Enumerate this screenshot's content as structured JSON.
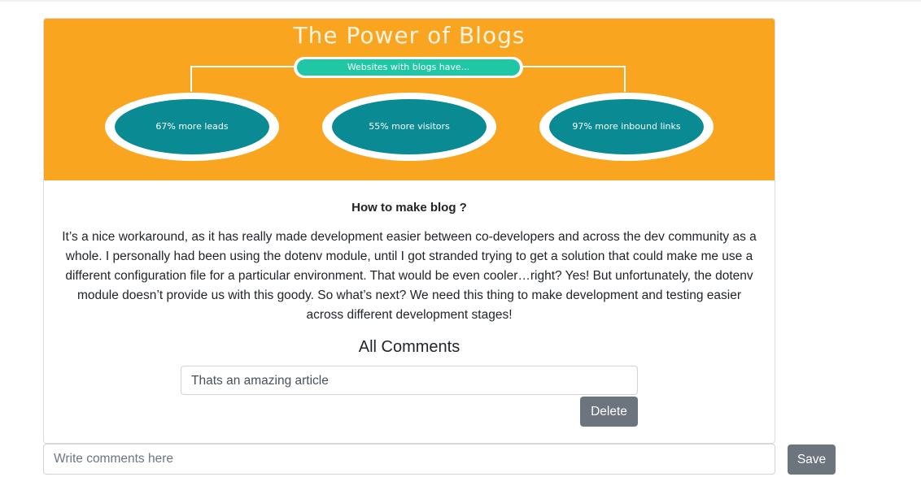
{
  "banner": {
    "title": "The Power of Blogs",
    "pill": "Websites with blogs have...",
    "stats": [
      "67% more leads",
      "55% more visitors",
      "97% more inbound links"
    ],
    "colors": {
      "background": "#f9a51f",
      "pill": "#1fc7a5",
      "circle": "#0a8b93"
    }
  },
  "post": {
    "title": "How to make blog ?",
    "body": "It’s a nice workaround, as it has really made development easier between co-developers and across the dev community as a whole. I personally had been using the dotenv module, until I got stranded trying to get a solution that could make me use a different configuration file for a particular environment. That would be even cooler…right? Yes! But unfortunately, the dotenv module doesn’t provide us with this goody. So what’s next? We need this thing to make development and testing easier across different development stages!"
  },
  "comments": {
    "heading": "All Comments",
    "items": [
      {
        "text": "Thats an amazing article",
        "delete_label": "Delete"
      }
    ]
  },
  "new_comment": {
    "placeholder": "Write comments here",
    "value": "",
    "save_label": "Save"
  },
  "colors": {
    "button": "#6c757d",
    "border": "#ced4da"
  }
}
